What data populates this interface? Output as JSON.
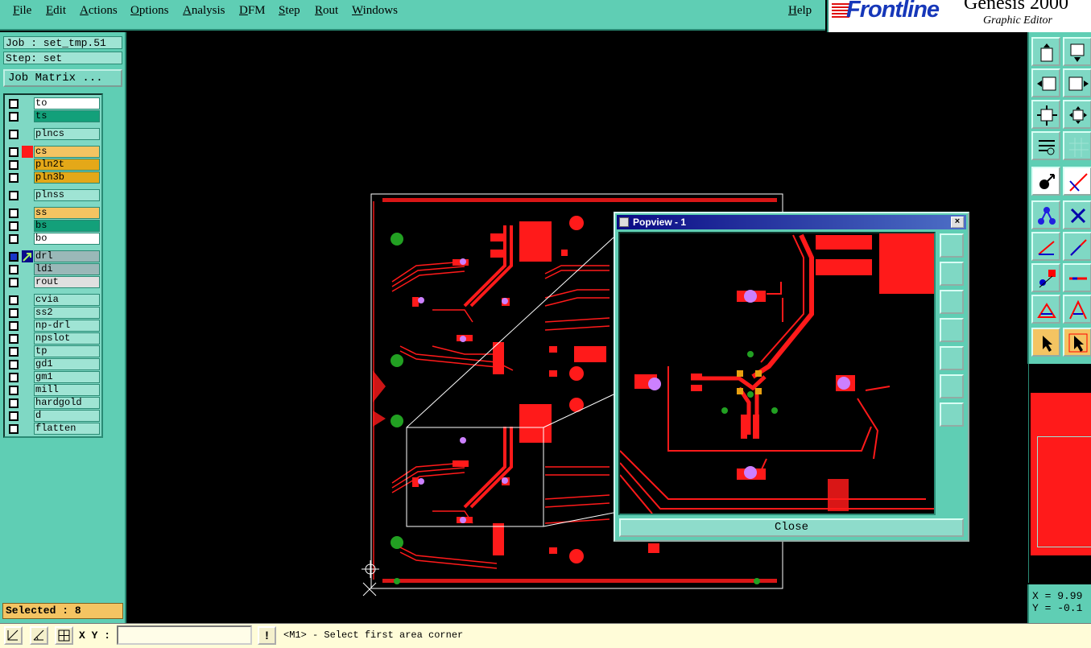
{
  "menu": {
    "file": "File",
    "edit": "Edit",
    "actions": "Actions",
    "options": "Options",
    "analysis": "Analysis",
    "dfm": "DFM",
    "step": "Step",
    "rout": "Rout",
    "windows": "Windows",
    "help": "Help"
  },
  "logo": {
    "brand": "Frontline",
    "product": "Genesis 2000",
    "subtitle": "Graphic Editor"
  },
  "job": {
    "job_line": "Job : set_tmp.51",
    "step_line": "Step: set",
    "matrix_button": "Job Matrix ..."
  },
  "layers": [
    {
      "name": "to",
      "color": "#ffffff"
    },
    {
      "name": "ts",
      "color": "#13a07a"
    },
    {
      "name": "plncs",
      "color": "#9fe4d4"
    },
    {
      "name": "cs",
      "color": "#f4c462"
    },
    {
      "name": "pln2t",
      "color": "#e4a818"
    },
    {
      "name": "pln3b",
      "color": "#e4a818"
    },
    {
      "name": "plnss",
      "color": "#9fe4d4"
    },
    {
      "name": "ss",
      "color": "#f4c462"
    },
    {
      "name": "bs",
      "color": "#13a07a"
    },
    {
      "name": "bo",
      "color": "#ffffff"
    },
    {
      "name": "drl",
      "color": "#9ab8b8"
    },
    {
      "name": "ldi",
      "color": "#9ab8b8"
    },
    {
      "name": "rout",
      "color": "#e0e0e0"
    },
    {
      "name": "cvia",
      "color": "#9fe4d4"
    },
    {
      "name": "ss2",
      "color": "#9fe4d4"
    },
    {
      "name": "np-drl",
      "color": "#9fe4d4"
    },
    {
      "name": "npslot",
      "color": "#9fe4d4"
    },
    {
      "name": "tp",
      "color": "#9fe4d4"
    },
    {
      "name": "gd1",
      "color": "#9fe4d4"
    },
    {
      "name": "gm1",
      "color": "#9fe4d4"
    },
    {
      "name": "mill",
      "color": "#9fe4d4"
    },
    {
      "name": "hardgold",
      "color": "#9fe4d4"
    },
    {
      "name": "d",
      "color": "#9fe4d4"
    },
    {
      "name": "flatten",
      "color": "#9fe4d4"
    }
  ],
  "status": {
    "selected": "Selected : 8"
  },
  "bottom": {
    "xy_label": "X Y :",
    "xy_value": "",
    "excl": "!",
    "prompt": "<M1> - Select first area corner"
  },
  "coords": {
    "x": "X = 9.99",
    "y": "Y = -0.1"
  },
  "popview": {
    "title": "Popview - 1",
    "close_x": "×",
    "close_button": "Close"
  },
  "colors": {
    "panel": "#5fceb4",
    "copper": "#ff1a1a",
    "pad": "#cc80ff",
    "via": "#22a022",
    "select": "#f4c462"
  },
  "icons": {
    "tool_buttons": [
      "pan-up-icon",
      "pan-down-icon",
      "pan-left-icon",
      "pan-right-icon",
      "zoom-fit-icon",
      "zoom-center-icon",
      "measure-icon",
      "grid-icon",
      "select-one-icon",
      "select-line-icon",
      "connect-icon",
      "delete-icon",
      "draw-line-icon",
      "draw-arc-icon",
      "pad-add-icon",
      "line-add-icon",
      "triangle-icon",
      "triangle-select-icon",
      "pointer-icon",
      "pointer-select-icon"
    ]
  }
}
